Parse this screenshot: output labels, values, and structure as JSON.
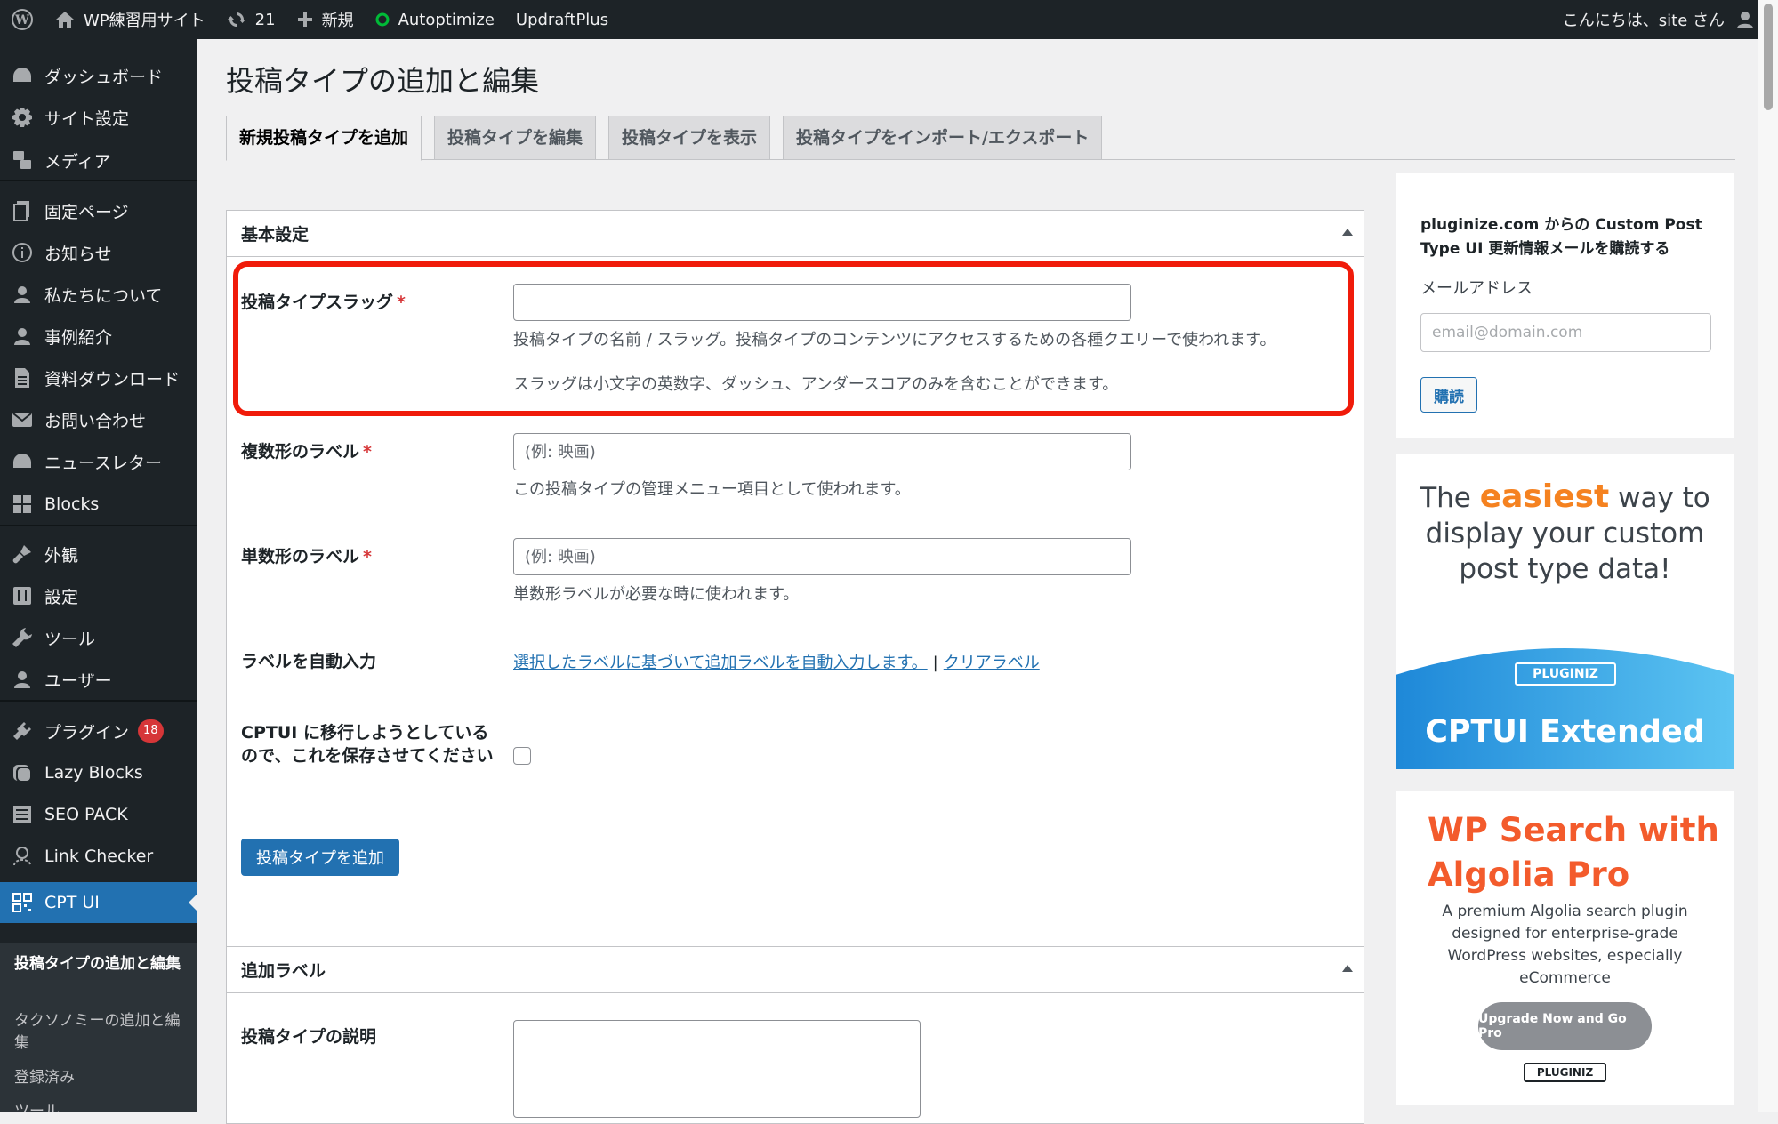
{
  "admin_bar": {
    "site_name": "WP練習用サイト",
    "updates_count": "21",
    "new_label": "新規",
    "plugin1": "Autoptimize",
    "plugin2": "UpdraftPlus",
    "greeting": "こんにちは、site さん"
  },
  "sidebar": {
    "items": [
      {
        "label": "ダッシュボード",
        "icon": "dashboard-icon"
      },
      {
        "label": "サイト設定",
        "icon": "gear-icon"
      },
      {
        "label": "メディア",
        "icon": "media-icon"
      },
      {
        "label": "固定ページ",
        "icon": "pages-icon"
      },
      {
        "label": "お知らせ",
        "icon": "info-icon"
      },
      {
        "label": "私たちについて",
        "icon": "user-icon"
      },
      {
        "label": "事例紹介",
        "icon": "user-icon"
      },
      {
        "label": "資料ダウンロード",
        "icon": "document-icon"
      },
      {
        "label": "お問い合わせ",
        "icon": "mail-icon"
      },
      {
        "label": "ニュースレター",
        "icon": "dashboard-icon"
      },
      {
        "label": "Blocks",
        "icon": "blocks-icon"
      },
      {
        "label": "外観",
        "icon": "brush-icon"
      },
      {
        "label": "設定",
        "icon": "settings-icon"
      },
      {
        "label": "ツール",
        "icon": "wrench-icon"
      },
      {
        "label": "ユーザー",
        "icon": "user-icon"
      },
      {
        "label": "プラグイン",
        "icon": "plugin-icon",
        "badge": "18"
      },
      {
        "label": "Lazy Blocks",
        "icon": "lazyblocks-icon"
      },
      {
        "label": "SEO PACK",
        "icon": "list-icon"
      },
      {
        "label": "Link Checker",
        "icon": "linkchecker-icon"
      },
      {
        "label": "CPT UI",
        "icon": "cptui-icon"
      }
    ],
    "submenu": [
      "投稿タイプの追加と編集",
      "タクソノミーの追加と編集",
      "登録済み",
      "ツール"
    ]
  },
  "main": {
    "title": "投稿タイプの追加と編集",
    "tabs": [
      "新規投稿タイプを追加",
      "投稿タイプを編集",
      "投稿タイプを表示",
      "投稿タイプをインポート/エクスポート"
    ],
    "basic": {
      "header": "基本設定",
      "slug_label": "投稿タイプスラッグ",
      "slug_value": "",
      "slug_desc1": "投稿タイプの名前 / スラッグ。投稿タイプのコンテンツにアクセスするための各種クエリーで使われます。",
      "slug_desc2": "スラッグは小文字の英数字、ダッシュ、アンダースコアのみを含むことができます。",
      "plural_label": "複数形のラベル",
      "plural_placeholder": "(例: 映画)",
      "plural_desc": "この投稿タイプの管理メニュー項目として使われます。",
      "singular_label": "単数形のラベル",
      "singular_placeholder": "(例: 映画)",
      "singular_desc": "単数形ラベルが必要な時に使われます。",
      "autofill_label": "ラベルを自動入力",
      "autofill_link": "選択したラベルに基づいて追加ラベルを自動入力します。",
      "separator": "|",
      "clear_link": "クリアラベル",
      "migrate_label": "CPTUI に移行しようとしているので、これを保存させてください",
      "submit": "投稿タイプを追加",
      "required_mark": "*"
    },
    "additional": {
      "header": "追加ラベル",
      "desc_label": "投稿タイプの説明"
    }
  },
  "right": {
    "subscribe_title": "pluginize.com からの Custom Post Type UI 更新情報メールを購読する",
    "email_label": "メールアドレス",
    "email_placeholder": "email@domain.com",
    "subscribe_button": "購読",
    "ad1": {
      "line1_pre": "The ",
      "line1_accent": "easiest",
      "line1_post": " way to",
      "line2": "display your custom",
      "line3": "post type data!",
      "logo": "PLUGINIZ",
      "brand": "CPTUI Extended"
    },
    "ad2": {
      "title": "WP Search with Algolia Pro",
      "desc": "A premium Algolia search plugin designed for enterprise-grade WordPress websites, especially eCommerce",
      "button": "Upgrade Now and Go Pro",
      "logo": "PLUGINIZ"
    }
  },
  "colors": {
    "accent": "#2271b1",
    "highlight": "#f01b0a",
    "sidebar_bg": "#1d2327",
    "badge": "#d63638"
  }
}
